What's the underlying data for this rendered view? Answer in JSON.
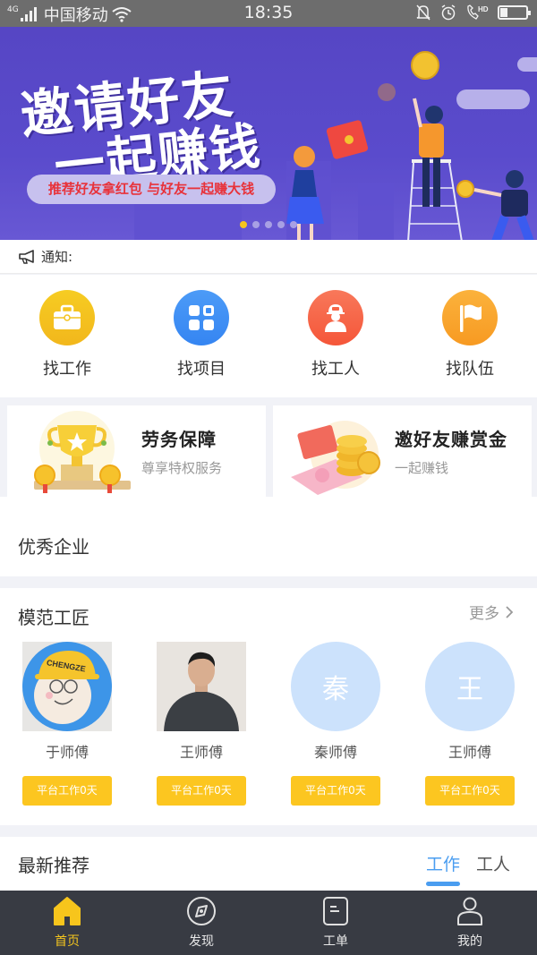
{
  "status_bar": {
    "network_type": "4G",
    "carrier": "中国移动",
    "time": "18:35",
    "icons": [
      "signal-icon",
      "wifi-icon",
      "bell-muted-icon",
      "alarm-icon",
      "hd-call-icon",
      "battery-icon"
    ],
    "battery_level": 0.25
  },
  "banner": {
    "title_line1": "邀请好友",
    "title_line2": "一起赚钱",
    "subtitle": "推荐好友拿红包 与好友一起赚大钱",
    "slide_count": 5,
    "active_slide": 1,
    "colors": {
      "background": "#5646c4",
      "pill_text": "#e8323a",
      "dot_active": "#f7c51c"
    }
  },
  "notice": {
    "icon": "megaphone-icon",
    "label": "通知:"
  },
  "quick_nav": [
    {
      "label": "找工作",
      "icon": "briefcase-icon",
      "color": "#f4c31d"
    },
    {
      "label": "找项目",
      "icon": "grid-icon",
      "color": "#3d8ef5"
    },
    {
      "label": "找工人",
      "icon": "worker-helmet-icon",
      "color": "#f76547"
    },
    {
      "label": "找队伍",
      "icon": "flag-icon",
      "color": "#f9a52a"
    }
  ],
  "promos": [
    {
      "title": "劳务保障",
      "subtitle": "尊享特权服务",
      "icon": "trophy-icon"
    },
    {
      "title": "邀好友赚赏金",
      "subtitle": "一起赚钱",
      "icon": "coins-card-icon"
    }
  ],
  "enterprise_section": {
    "title": "优秀企业"
  },
  "craftsmen_section": {
    "title": "模范工匠",
    "more_label": "更多",
    "items": [
      {
        "name": "于师傅",
        "avatar_type": "cartoon",
        "avatar_text": "",
        "badge": "平台工作0天"
      },
      {
        "name": "王师傅",
        "avatar_type": "photo",
        "avatar_text": "",
        "badge": "平台工作0天"
      },
      {
        "name": "秦师傅",
        "avatar_type": "initial",
        "avatar_text": "秦",
        "badge": "平台工作0天"
      },
      {
        "name": "王师傅",
        "avatar_type": "initial",
        "avatar_text": "王",
        "badge": "平台工作0天"
      }
    ]
  },
  "latest_section": {
    "title": "最新推荐",
    "tabs": [
      {
        "label": "工作",
        "active": true
      },
      {
        "label": "工人",
        "active": false
      }
    ],
    "accent": "#4a9df0"
  },
  "bottom_nav": [
    {
      "label": "首页",
      "icon": "home-icon",
      "active": true
    },
    {
      "label": "发现",
      "icon": "compass-icon",
      "active": false
    },
    {
      "label": "工单",
      "icon": "document-icon",
      "active": false
    },
    {
      "label": "我的",
      "icon": "user-icon",
      "active": false
    }
  ]
}
